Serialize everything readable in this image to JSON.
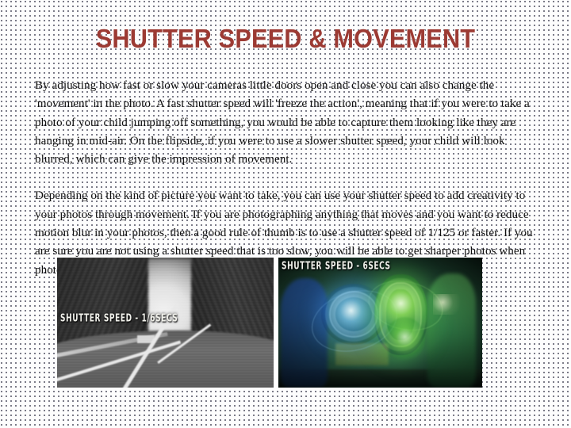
{
  "slide": {
    "title": "SHUTTER SPEED & MOVEMENT",
    "title_color": "#9C3A33",
    "background_color": "#FDFDFD",
    "background_pattern": "dotted-grid"
  },
  "body": {
    "paragraph1": "By adjusting how fast or slow your cameras little doors open and close you can also change the 'movement' in the photo. A fast shutter speed will 'freeze the action', meaning that if you were to take a photo of your child jumping off something, you would be able to capture them looking like they are hanging in mid-air. On the flipside, if you were to use a slower shutter speed, your child will look blurred, which can give the impression of movement.",
    "paragraph2": "Depending on the kind of picture you want to take, you can use your shutter speed to add creativity to your photos through movement. If you are photographing anything that moves and you want to reduce motion blur in your photos, then a good rule of thumb is to use a shutter speed of 1/125 or faster. If you are sure you are not using a shutter speed that is too slow, you will be able to get sharper photos when photographing moving subjects."
  },
  "photos": [
    {
      "name": "road-long-exposure",
      "caption": "SHUTTER SPEED - 1/6SECS",
      "description": "Black and white motion blurred photo of a road through trees"
    },
    {
      "name": "light-painting",
      "caption": "SHUTTER SPEED - 6SECS",
      "description": "Green and blue light painting long exposure with two people and glowing orbs"
    }
  ]
}
